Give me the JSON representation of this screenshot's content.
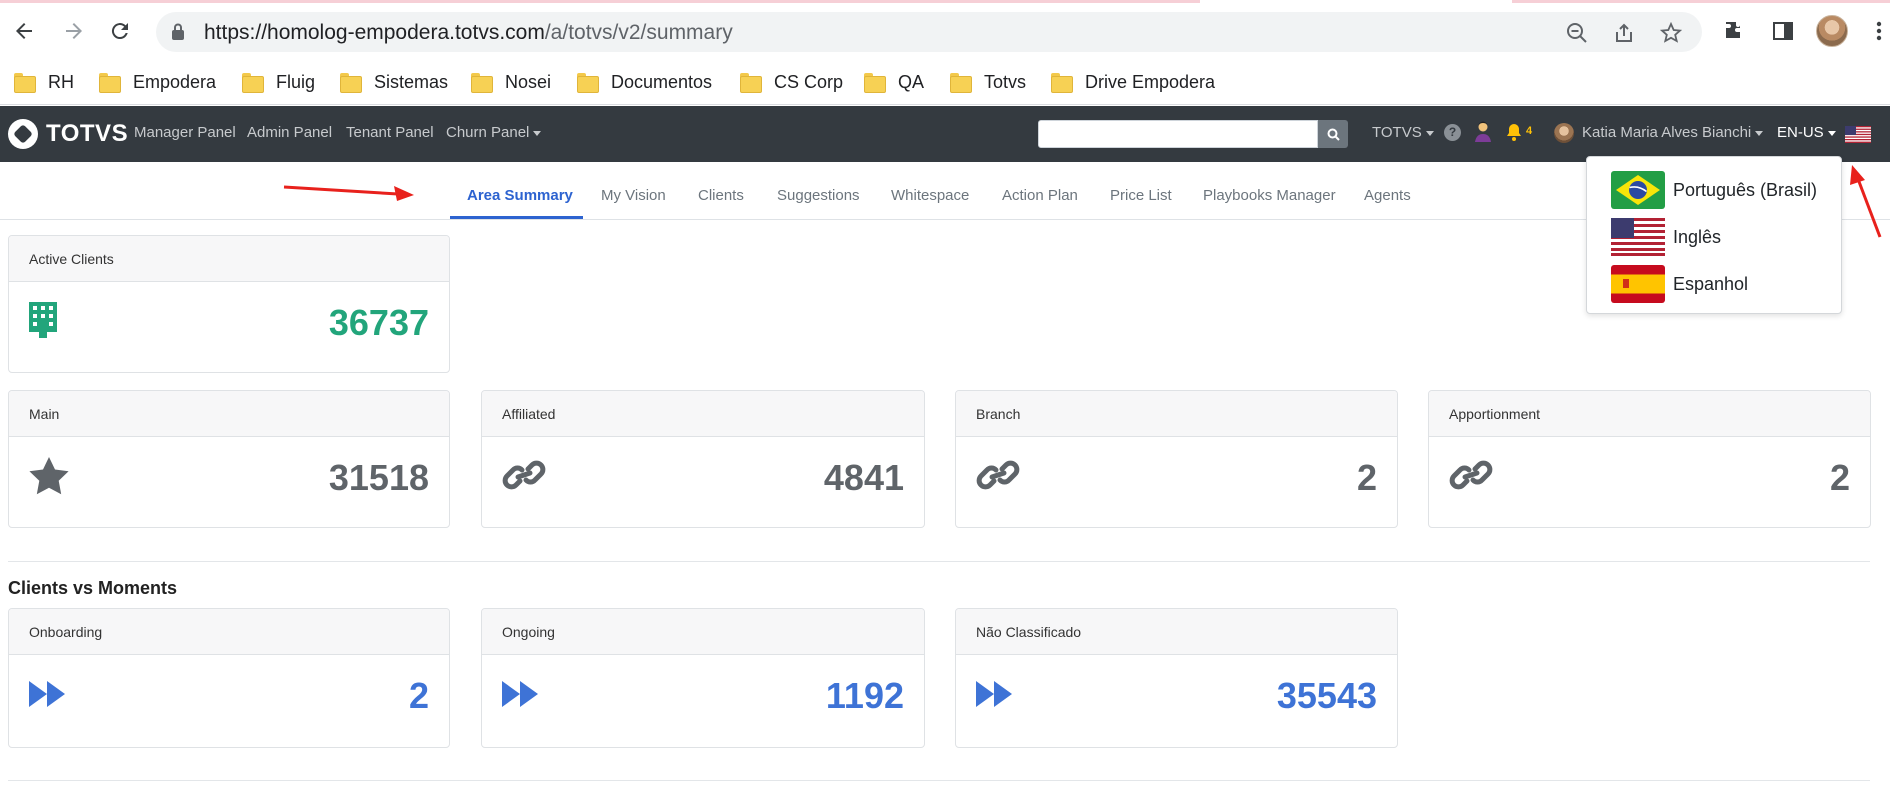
{
  "browser": {
    "url_host": "https://homolog-empodera.totvs.com",
    "url_path": "/a/totvs/v2/summary",
    "bookmarks": [
      "RH",
      "Empodera",
      "Fluig",
      "Sistemas",
      "Nosei",
      "Documentos",
      "CS Corp",
      "QA",
      "Totvs",
      "Drive Empodera"
    ]
  },
  "navbar": {
    "brand": "TOTVS",
    "links": [
      "Manager Panel",
      "Admin Panel",
      "Tenant Panel",
      "Churn Panel"
    ],
    "search_placeholder": "",
    "org_menu": "TOTVS",
    "help": "?",
    "notification_count": "4",
    "user_name": "Katia Maria Alves Bianchi",
    "language": "EN-US"
  },
  "tabs": [
    "Area Summary",
    "My Vision",
    "Clients",
    "Suggestions",
    "Whitespace",
    "Action Plan",
    "Price List",
    "Playbooks Manager",
    "Agents"
  ],
  "active_tab": "Area Summary",
  "language_menu": {
    "items": [
      "Português (Brasil)",
      "Inglês",
      "Espanhol"
    ]
  },
  "summary": {
    "active_clients": {
      "label": "Active Clients",
      "value": "36737"
    },
    "main": {
      "label": "Main",
      "value": "31518"
    },
    "affiliated": {
      "label": "Affiliated",
      "value": "4841"
    },
    "branch": {
      "label": "Branch",
      "value": "2"
    },
    "apportionment": {
      "label": "Apportionment",
      "value": "2"
    }
  },
  "moments": {
    "title": "Clients vs Moments",
    "onboarding": {
      "label": "Onboarding",
      "value": "2"
    },
    "ongoing": {
      "label": "Ongoing",
      "value": "1192"
    },
    "not_classified": {
      "label": "Não Classificado",
      "value": "35543"
    }
  },
  "colors": {
    "navbar": "#343a40",
    "accent_blue": "#2d63d0",
    "value_green": "#22a57b",
    "value_gray": "#5f6469",
    "value_blue": "#3e73d6",
    "annotation_red": "#e8211c"
  },
  "icons": {
    "active_clients": "building-icon",
    "main": "star-icon",
    "affiliated": "link-icon",
    "branch": "link-icon",
    "apportionment": "link-icon",
    "moments": "fast-forward-icon"
  }
}
